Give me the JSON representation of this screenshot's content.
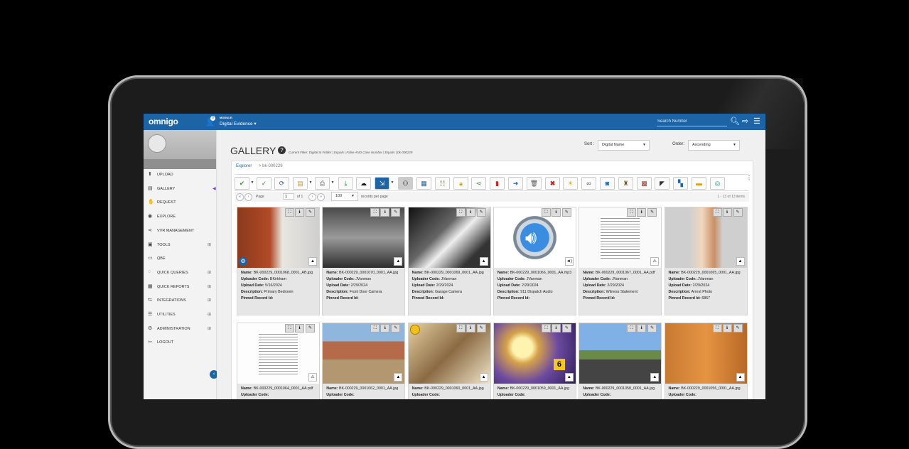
{
  "app": {
    "logo": "omnigo",
    "notifications": "0",
    "module_label": "MODULE:",
    "module_value": "Digital Evidence ▾",
    "search_placeholder": "Search Number"
  },
  "sidebar": {
    "items": [
      {
        "label": "UPLOAD",
        "icon": "upload-icon",
        "glyph": "⬆"
      },
      {
        "label": "GALLERY",
        "icon": "gallery-icon",
        "glyph": "▤"
      },
      {
        "label": "REQUEST",
        "icon": "hand-icon",
        "glyph": "✋"
      },
      {
        "label": "EXPLORE",
        "icon": "globe-icon",
        "glyph": "◉"
      },
      {
        "label": "VVR MANAGEMENT",
        "icon": "share-icon",
        "glyph": "⋖"
      },
      {
        "label": "TOOLS",
        "icon": "briefcase-icon",
        "glyph": "▣"
      },
      {
        "label": "QBE",
        "icon": "folder-icon",
        "glyph": "▭"
      },
      {
        "label": "QUICK QUERIES",
        "icon": "chat-icon",
        "glyph": "◌"
      },
      {
        "label": "QUICK REPORTS",
        "icon": "chart-icon",
        "glyph": "▦"
      },
      {
        "label": "INTEGRATIONS",
        "icon": "link-icon",
        "glyph": "⇆"
      },
      {
        "label": "UTILITIES",
        "icon": "list-icon",
        "glyph": "☰"
      },
      {
        "label": "ADMINISTRATION",
        "icon": "gear-icon",
        "glyph": "⚙"
      },
      {
        "label": "LOGOUT",
        "icon": "logout-icon",
        "glyph": "⇦"
      }
    ]
  },
  "gallery": {
    "title": "GALLERY",
    "filter_text": "Current Filter: Digital to Folder | Equals | False AND Case Number | Equals | bk-000229",
    "sort_label": "Sort :",
    "sort_value": "Digital Name",
    "order_label": "Order:",
    "order_value": "Ascending",
    "breadcrumb_root": "Explorer",
    "breadcrumb_current": "> bk-000229"
  },
  "pager": {
    "page_label": "Page",
    "page_value": "1",
    "of_label": "of 1",
    "per_page": "100",
    "per_page_label": "records per page",
    "count": "1 - 13 of 13 items"
  },
  "cards": [
    {
      "name": "BK-000229_0001068_0001_AB.jpg",
      "uploader": "BKirkham",
      "date": "5/16/2024",
      "desc": "Primary Bedroom",
      "pinned": ""
    },
    {
      "name": "BK-000229_0001070_0001_AA.jpg",
      "uploader": "JVanman",
      "date": "2/29/2024",
      "desc": "Front Door Camera",
      "pinned": ""
    },
    {
      "name": "BK-000229_0001069_0001_AA.jpg",
      "uploader": "JVanman",
      "date": "2/29/2024",
      "desc": "Garage Camera",
      "pinned": ""
    },
    {
      "name": "BK-000229_0001066_0001_AA.mp3",
      "uploader": "JVanman",
      "date": "2/29/2024",
      "desc": "911 Dispatch Audio",
      "pinned": ""
    },
    {
      "name": "BK-000229_0001067_0001_AA.pdf",
      "uploader": "JVanman",
      "date": "2/29/2024",
      "desc": "Witness Statement",
      "pinned": ""
    },
    {
      "name": "BK-000229_0001065_0001_AA.jpg",
      "uploader": "JVanman",
      "date": "2/29/2024",
      "desc": "Arrest Photo",
      "pinned": "6867"
    },
    {
      "name": "BK-000229_0001064_0001_AA.pdf",
      "uploader": "",
      "date": "",
      "desc": "",
      "pinned": ""
    },
    {
      "name": "BK-000229_0001062_0001_AA.jpg",
      "uploader": "",
      "date": "",
      "desc": "",
      "pinned": ""
    },
    {
      "name": "BK-000229_0001060_0001_AA.jpg",
      "uploader": "",
      "date": "",
      "desc": "",
      "pinned": ""
    },
    {
      "name": "BK-000229_0001059_0001_AA.jpg",
      "uploader": "",
      "date": "",
      "desc": "",
      "pinned": ""
    },
    {
      "name": "BK-000229_0001058_0001_AA.jpg",
      "uploader": "",
      "date": "",
      "desc": "",
      "pinned": ""
    },
    {
      "name": "BK-000229_0001056_0001_AA.jpg",
      "uploader": "",
      "date": "",
      "desc": "",
      "pinned": ""
    }
  ],
  "labels": {
    "name": "Name:",
    "uploader": "Uploader Code:",
    "date": "Upload Date:",
    "desc": "Description:",
    "pinned": "Pinned Record Id:"
  }
}
